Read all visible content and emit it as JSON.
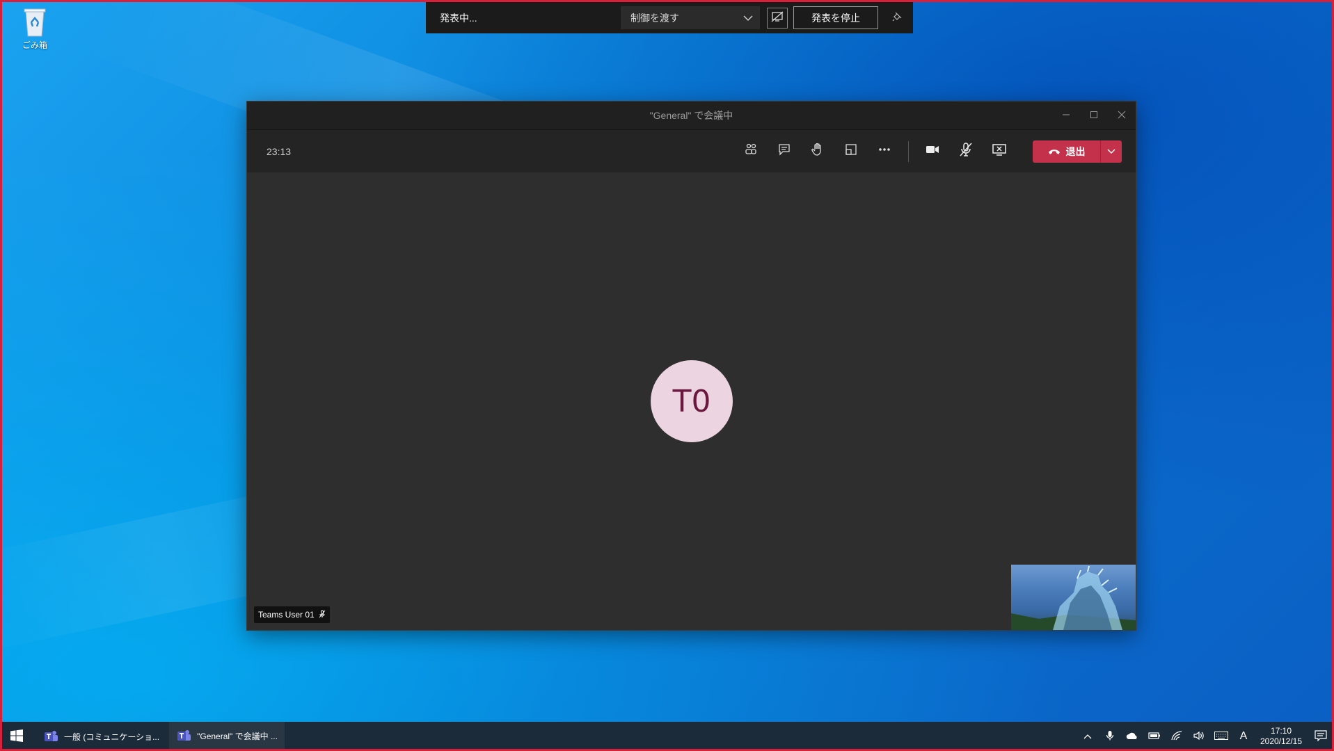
{
  "desktop": {
    "recycle_bin_label": "ごみ箱"
  },
  "presenter_bar": {
    "status": "発表中...",
    "give_control": "制御を渡す",
    "stop_presenting": "発表を停止"
  },
  "window": {
    "title": "\"General\" で会議中"
  },
  "meeting": {
    "timer": "23:13",
    "leave_label": "退出",
    "avatar_initials": "T0",
    "participant_name": "Teams User 01"
  },
  "taskbar": {
    "apps": [
      {
        "label": "一般 (コミュニケーショ..."
      },
      {
        "label": "\"General\" で会議中 ..."
      }
    ],
    "ime": "A",
    "time": "17:10",
    "date": "2020/12/15"
  },
  "colors": {
    "leave_red": "#c4314b",
    "avatar_bg": "#ecd4e0",
    "avatar_text": "#6a1840",
    "taskbar": "#1c2b3a"
  },
  "icons": {
    "toolbar": [
      "participants-icon",
      "chat-icon",
      "raise-hand-icon",
      "rooms-icon",
      "more-icon",
      "camera-icon",
      "mic-off-icon",
      "stop-share-icon",
      "phone-hangup-icon",
      "chevron-down-icon"
    ],
    "tray": [
      "chevron-up-icon",
      "microphone-icon",
      "onedrive-icon",
      "battery-icon",
      "wifi-icon",
      "volume-icon",
      "keyboard-icon",
      "notification-icon"
    ]
  }
}
